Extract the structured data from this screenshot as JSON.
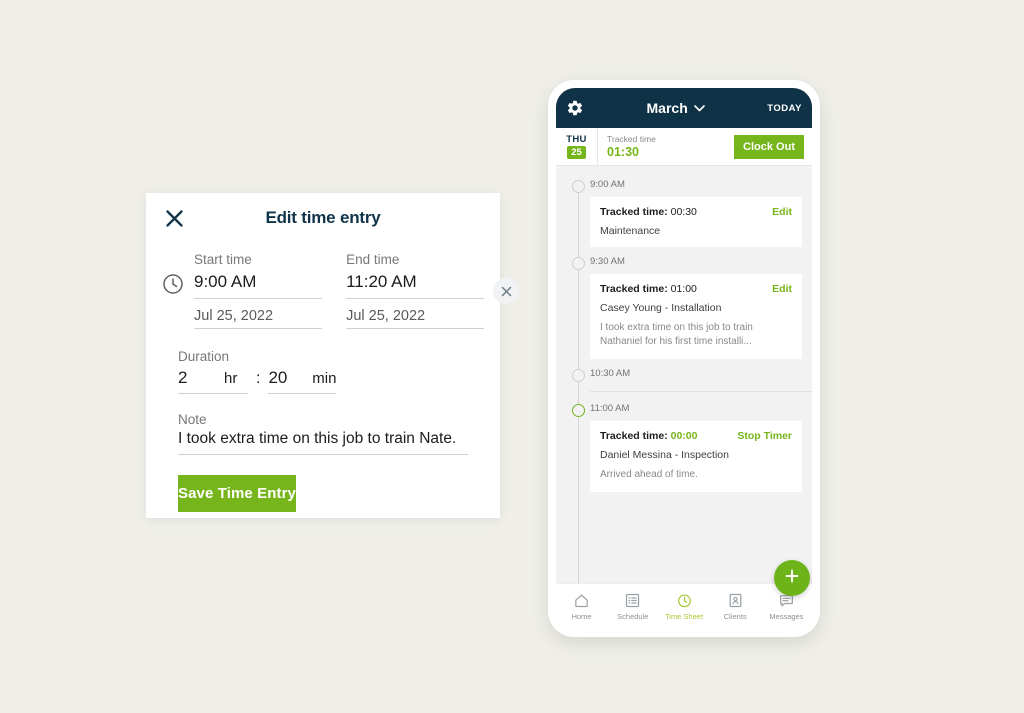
{
  "modal": {
    "title": "Edit time entry",
    "close_icon": "close-icon",
    "clock_icon": "clock-icon",
    "start": {
      "label": "Start time",
      "value": "9:00 AM",
      "date": "Jul 25, 2022"
    },
    "end": {
      "label": "End time",
      "value": "11:20 AM",
      "date": "Jul 25, 2022",
      "clear_icon": "clear-circle-icon"
    },
    "duration": {
      "label": "Duration",
      "hours": "2",
      "hours_unit": "hr",
      "separator": ":",
      "minutes": "20",
      "minutes_unit": "min"
    },
    "note": {
      "label": "Note",
      "value": "I took extra time on this job to train Nate."
    },
    "save_label": "Save Time Entry"
  },
  "phone": {
    "header": {
      "settings_icon": "gear-icon",
      "month": "March",
      "chevron_icon": "chevron-down-icon",
      "today_label": "TODAY"
    },
    "subbar": {
      "day_of_week": "THU",
      "day_number": "25",
      "tracked_label": "Tracked time",
      "tracked_value": "01:30",
      "clock_out_label": "Clock Out"
    },
    "timeline": [
      {
        "time": "9:00 AM",
        "active": false,
        "card": {
          "tracked_label": "Tracked time:",
          "tracked_value": "00:30",
          "tracked_value_green": false,
          "action": "Edit",
          "subject": "Maintenance",
          "note": ""
        }
      },
      {
        "time": "9:30 AM",
        "active": false,
        "card": {
          "tracked_label": "Tracked time:",
          "tracked_value": "01:00",
          "tracked_value_green": false,
          "action": "Edit",
          "subject": "Casey Young - Installation",
          "note": "I took extra time on this job to train Nathaniel for his first time installi..."
        }
      },
      {
        "time": "10:30 AM",
        "active": false,
        "card": null
      },
      {
        "time": "11:00 AM",
        "active": true,
        "card": {
          "tracked_label": "Tracked time:",
          "tracked_value": "00:00",
          "tracked_value_green": true,
          "action": "Stop Timer",
          "subject": "Daniel Messina - Inspection",
          "note": "Arrived ahead of time."
        }
      }
    ],
    "tabs": [
      {
        "label": "Home",
        "icon": "home-icon",
        "active": false
      },
      {
        "label": "Schedule",
        "icon": "list-icon",
        "active": false
      },
      {
        "label": "Time Sheet",
        "icon": "clock-icon",
        "active": true
      },
      {
        "label": "Clients",
        "icon": "contact-icon",
        "active": false
      },
      {
        "label": "Messages",
        "icon": "chat-icon",
        "active": false
      }
    ],
    "fab": {
      "icon": "plus-icon",
      "label": "+"
    }
  },
  "colors": {
    "brand_green": "#76b51b",
    "navy": "#0f3246",
    "page_bg": "#efeee8",
    "fab_green": "#6eb31a"
  }
}
